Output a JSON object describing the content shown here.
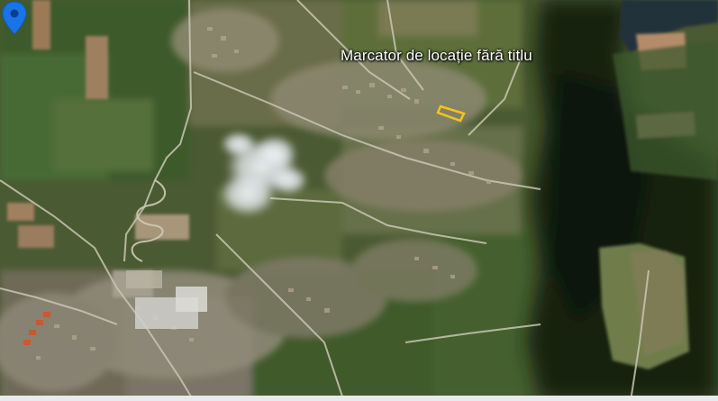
{
  "map": {
    "view_type": "satellite",
    "marker": {
      "label": "Marcator de locație fără titlu",
      "icon": "location-pin-icon",
      "color": "#1a73e8"
    },
    "parcel": {
      "outline_color": "#f5c518"
    }
  }
}
